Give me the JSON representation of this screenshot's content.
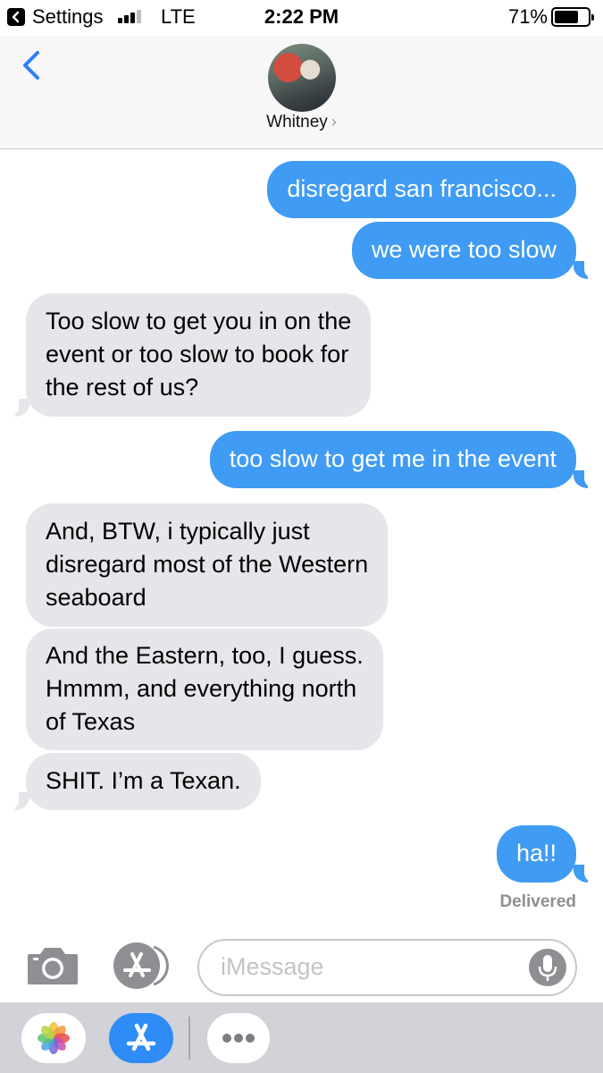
{
  "status_bar": {
    "app_back_label": "Settings",
    "carrier": "LTE",
    "time": "2:22 PM",
    "battery_percent": "71%",
    "battery_level": 0.71,
    "signal_bars": 3
  },
  "header": {
    "contact_name": "Whitney",
    "name_chevron": "›"
  },
  "messages": [
    {
      "direction": "sent",
      "lines": [
        "disregard san francisco..."
      ]
    },
    {
      "direction": "sent",
      "lines": [
        "we were too slow"
      ]
    },
    {
      "direction": "received",
      "lines": [
        "Too slow to get you in on the",
        "event or too slow to book for",
        "the rest of us?"
      ]
    },
    {
      "direction": "sent",
      "lines": [
        "too slow to get me in the event"
      ]
    },
    {
      "direction": "received",
      "lines": [
        "And, BTW, i typically just",
        "disregard most of the Western",
        "seaboard"
      ]
    },
    {
      "direction": "received",
      "lines": [
        "And the Eastern, too, I guess.",
        "Hmmm, and everything north",
        "of Texas"
      ]
    },
    {
      "direction": "received",
      "lines": [
        "SHIT. I’m a Texan."
      ]
    },
    {
      "direction": "sent",
      "lines": [
        "ha!!"
      ]
    }
  ],
  "delivery_status": "Delivered",
  "compose": {
    "placeholder": "iMessage"
  },
  "icons": {
    "back": "chevron-left-icon",
    "camera": "camera-icon",
    "apps": "app-store-icon",
    "mic": "microphone-icon",
    "photos": "photos-icon",
    "more": "more-icon"
  },
  "colors": {
    "sent_bubble": "#3f9bf3",
    "received_bubble": "#e5e5ea",
    "accent": "#2f7df6"
  }
}
